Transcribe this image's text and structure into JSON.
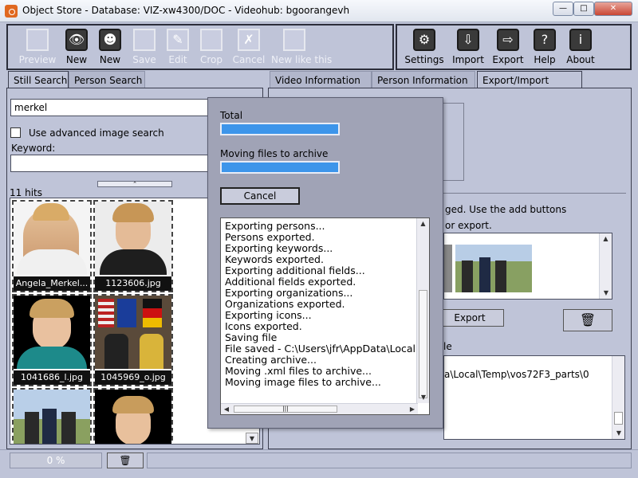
{
  "window": {
    "title": "Object Store  -  Database: VIZ-xw4300/DOC  -  Videohub: bgoorangevh",
    "minimize": "—",
    "maximize": "□",
    "close": "✕"
  },
  "toolbar": {
    "left": [
      {
        "label": "Preview",
        "enabled": false,
        "icon": "preview-icon"
      },
      {
        "label": "New",
        "enabled": true,
        "icon": "eye-icon"
      },
      {
        "label": "New",
        "enabled": true,
        "icon": "person-icon"
      },
      {
        "label": "Save",
        "enabled": false,
        "icon": "save-icon"
      },
      {
        "label": "Edit",
        "enabled": false,
        "icon": "edit-icon"
      },
      {
        "label": "Crop",
        "enabled": false,
        "icon": "crop-icon"
      },
      {
        "label": "Cancel",
        "enabled": false,
        "icon": "cancel-icon"
      },
      {
        "label": "New like this",
        "enabled": false,
        "icon": "new-like-this-icon"
      }
    ],
    "right": [
      {
        "label": "Settings",
        "enabled": true,
        "icon": "settings-icon"
      },
      {
        "label": "Import",
        "enabled": true,
        "icon": "import-icon"
      },
      {
        "label": "Export",
        "enabled": true,
        "icon": "export-icon"
      },
      {
        "label": "Help",
        "enabled": true,
        "icon": "help-icon"
      },
      {
        "label": "About",
        "enabled": true,
        "icon": "about-icon"
      }
    ]
  },
  "left_tabs": [
    "Still Search",
    "Person Search"
  ],
  "right_tabs": [
    "Video Information",
    "Person Information",
    "Export/Import"
  ],
  "search": {
    "query": "merkel",
    "advanced_label": "Use advanced image search",
    "keyword_label": "Keyword:",
    "keyword_value": "",
    "hits": "11 hits"
  },
  "thumbnails": [
    {
      "caption": "Angela_Merkel..."
    },
    {
      "caption": "1123606.jpg"
    },
    {
      "caption": "1041686_l.jpg"
    },
    {
      "caption": "1045969_o.jpg"
    },
    {
      "caption": ""
    },
    {
      "caption": ""
    }
  ],
  "dialog": {
    "total_label": "Total",
    "moving_label": "Moving files to archive",
    "total_progress": 1.0,
    "moving_progress": 1.0,
    "cancel": "Cancel",
    "log": [
      "Exporting persons...",
      "Persons exported.",
      "Exporting keywords...",
      "Keywords exported.",
      "Exporting additional fields...",
      "Additional fields exported.",
      "Exporting organizations...",
      "Organizations exported.",
      "Exporting icons...",
      "Icons exported.",
      "Saving file",
      "File saved - C:\\Users\\jfr\\AppData\\Local",
      "Creating archive...",
      "Moving .xml files to archive...",
      "Moving image files to archive..."
    ]
  },
  "right_content": {
    "hint_line1": "ged. Use the add buttons",
    "hint_line2": "or export.",
    "export_button": "Export",
    "file_label": "le",
    "path_text": "a\\Local\\Temp\\vos72F3_parts\\0"
  },
  "status": {
    "progress_text": "0 %"
  },
  "colors": {
    "background": "#bfc4d8",
    "dialog": "#a0a3b6",
    "progress": "#3d95ea"
  }
}
